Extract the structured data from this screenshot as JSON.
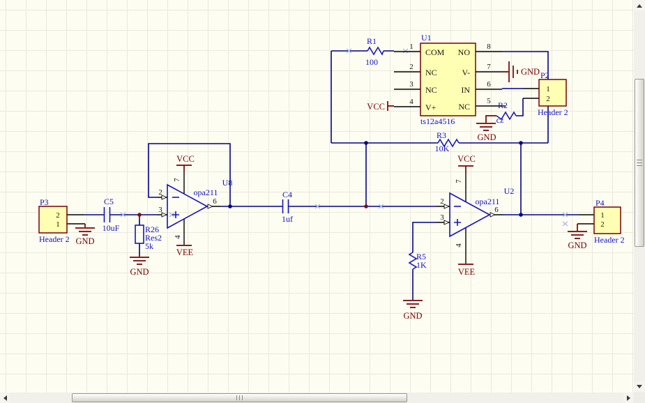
{
  "colors": {
    "background": "#FDFDF2",
    "grid": "#EBE9DD",
    "wire": "#00008B",
    "symbol": "#1414C0",
    "label_blue": "#1414C8",
    "power_red": "#7A0000",
    "pin_black": "#141414",
    "part_fill": "#FFFFB3",
    "part_border": "#7A0000",
    "junction_red": "#7A1010"
  },
  "schematic": {
    "u1": {
      "designator": "U1",
      "part": "ts12a4516",
      "left": [
        {
          "n": "1",
          "name": "COM"
        },
        {
          "n": "2",
          "name": "NC"
        },
        {
          "n": "3",
          "name": "NC"
        },
        {
          "n": "4",
          "name": "V+"
        }
      ],
      "right": [
        {
          "n": "8",
          "name": "NO"
        },
        {
          "n": "7",
          "name": "V-"
        },
        {
          "n": "6",
          "name": "IN"
        },
        {
          "n": "5",
          "name": "NC"
        }
      ]
    },
    "u8": {
      "designator": "U8",
      "part": "opa211",
      "p_inv": "2",
      "p_non": "3",
      "p_out": "6",
      "p_vp": "7",
      "p_vm": "4"
    },
    "u2": {
      "designator": "U2",
      "part": "opa211",
      "p_inv": "2",
      "p_non": "3",
      "p_out": "6",
      "p_vp": "7",
      "p_vm": "4"
    },
    "r1": {
      "d": "R1",
      "v": "100"
    },
    "r2": {
      "d": "R2",
      "v": "cz"
    },
    "r3": {
      "d": "R3",
      "v": "10K"
    },
    "r5": {
      "d": "R5",
      "v": "1K"
    },
    "r26": {
      "d": "R26",
      "t": "Res2",
      "v": "5k"
    },
    "c4": {
      "d": "C4",
      "v": "1uf"
    },
    "c5": {
      "d": "C5",
      "v": "10uF"
    },
    "p2": {
      "d": "P2",
      "part": "Header 2",
      "pins": [
        "1",
        "2"
      ]
    },
    "p3": {
      "d": "P3",
      "part": "Header 2",
      "pins": [
        "2",
        "1"
      ]
    },
    "p4": {
      "d": "P4",
      "part": "Header 2",
      "pins": [
        "1",
        "2"
      ]
    },
    "pw": {
      "vcc": "VCC",
      "vee": "VEE",
      "gnd": "GND"
    }
  }
}
